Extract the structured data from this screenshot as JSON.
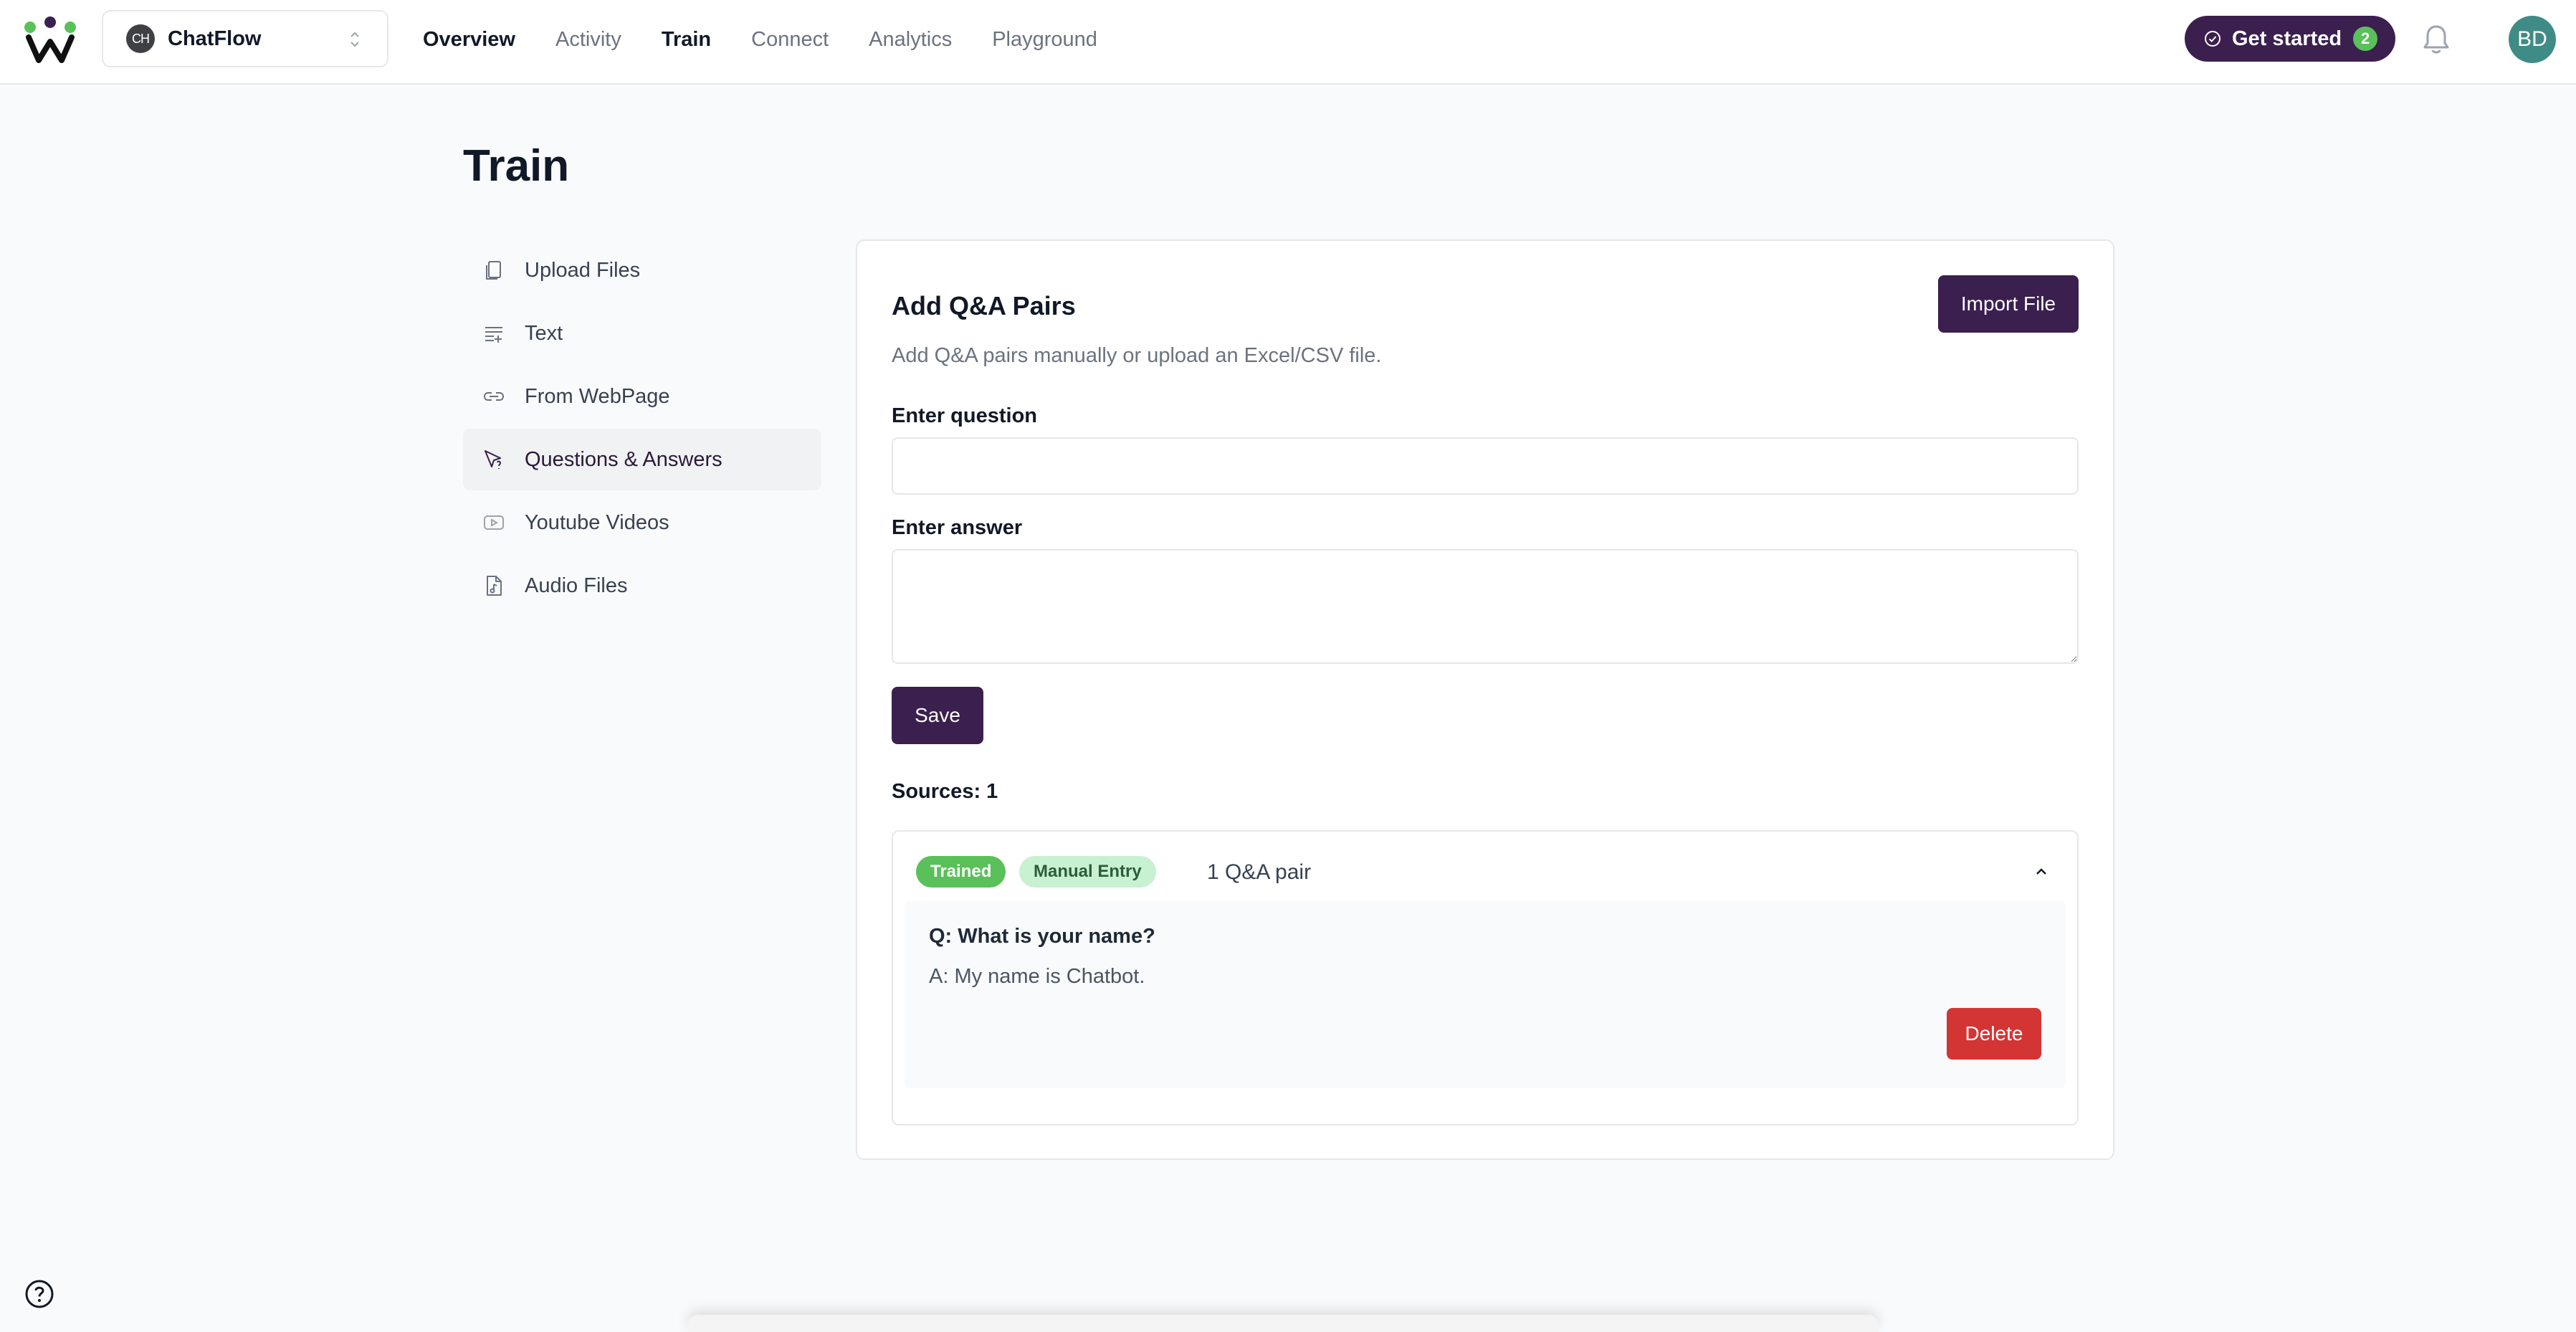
{
  "header": {
    "project": {
      "avatar_text": "CH",
      "name": "ChatFlow"
    },
    "nav": [
      {
        "label": "Overview"
      },
      {
        "label": "Activity"
      },
      {
        "label": "Train"
      },
      {
        "label": "Connect"
      },
      {
        "label": "Analytics"
      },
      {
        "label": "Playground"
      }
    ],
    "get_started": {
      "label": "Get started",
      "count": "2"
    },
    "user_initials": "BD"
  },
  "page": {
    "title": "Train"
  },
  "sidebar": {
    "items": [
      {
        "label": "Upload Files",
        "icon": "file-copy-icon"
      },
      {
        "label": "Text",
        "icon": "text-lines-icon"
      },
      {
        "label": "From WebPage",
        "icon": "link-icon"
      },
      {
        "label": "Questions & Answers",
        "icon": "cursor-question-icon",
        "active": true
      },
      {
        "label": "Youtube Videos",
        "icon": "video-play-icon"
      },
      {
        "label": "Audio Files",
        "icon": "audio-file-icon"
      }
    ]
  },
  "card": {
    "title": "Add Q&A Pairs",
    "description": "Add Q&A pairs manually or upload an Excel/CSV file.",
    "import_label": "Import File",
    "question_label": "Enter question",
    "question_value": "",
    "answer_label": "Enter answer",
    "answer_value": "",
    "save_label": "Save",
    "sources_label": "Sources: 1",
    "source": {
      "status_badge": "Trained",
      "type_badge": "Manual Entry",
      "pair_count": "1 Q&A pair",
      "question": "Q: What is your name?",
      "answer": "A: My name is Chatbot.",
      "delete_label": "Delete"
    }
  },
  "colors": {
    "brand": "#3b1f4f",
    "success": "#5ac05a",
    "danger": "#d33535",
    "avatar": "#3e8c85"
  }
}
